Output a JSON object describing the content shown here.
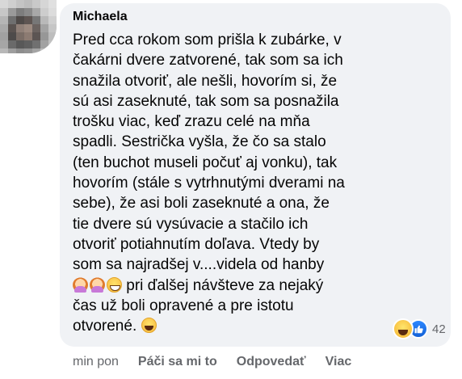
{
  "comment": {
    "author": "Michaela",
    "text_lines": [
      "Pred cca rokom som prišla k zubárke, v",
      "čakárni dvere zatvorené, tak som sa ich",
      "snažila otvoriť, ale nešli, hovorím si, že",
      "sú asi zaseknuté, tak som sa posnažila",
      "trošku viac, keď zrazu celé na mňa",
      "spadli. Sestrička vyšla, že čo sa stalo",
      "(ten buchot museli počuť aj vonku), tak",
      "hovorím (stále s vytrhnutými dverami na",
      "sebe), že asi boli zaseknuté a ona, že",
      "tie dvere sú vysúvacie a stačilo ich",
      "otvoriť potiahnutím doľava. Vtedy by",
      "som sa najradšej v....videla od hanby"
    ],
    "line_13_text": " pri ďalšej návšteve za nejaký",
    "line_14": "čas už boli opravené a pre istotu",
    "line_15_text": "otvorené. ",
    "inline_emojis": [
      "facepalm-icon",
      "facepalm-icon",
      "grinning-face-icon",
      "laughing-face-icon"
    ]
  },
  "reactions": {
    "icons": [
      "haha-reaction-icon",
      "like-reaction-icon"
    ],
    "count": "42",
    "like_color": "#1877f2"
  },
  "actions": {
    "time": "min pon",
    "like_label": "Páči sa mi to",
    "reply_label": "Odpovedať",
    "more_label": "Viac"
  },
  "colors": {
    "bubble_bg": "#f0f2f5",
    "text": "#050505",
    "secondary_text": "#65676b"
  }
}
